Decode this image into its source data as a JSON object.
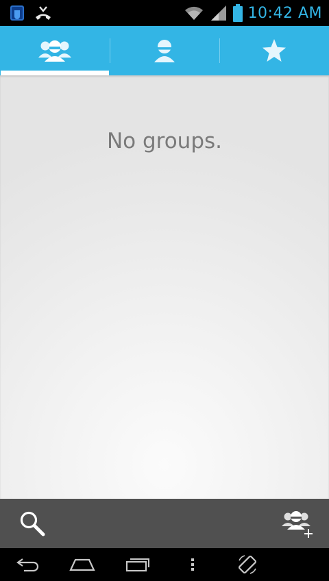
{
  "status_bar": {
    "time": "10:42 AM",
    "icons": [
      "notification-app-icon",
      "missed-call-icon",
      "wifi-icon",
      "signal-icon",
      "battery-icon"
    ]
  },
  "tabs": [
    {
      "name": "groups",
      "icon": "groups-icon",
      "selected": true
    },
    {
      "name": "contacts",
      "icon": "person-icon",
      "selected": false
    },
    {
      "name": "favorites",
      "icon": "star-icon",
      "selected": false
    }
  ],
  "main": {
    "empty_message": "No groups."
  },
  "action_bar": {
    "left_icon": "search-icon",
    "right_icon": "add-group-icon"
  },
  "nav_bar": {
    "icons": [
      "back-icon",
      "home-icon",
      "recent-apps-icon",
      "menu-icon",
      "rotate-icon"
    ]
  },
  "colors": {
    "accent": "#33b5e5",
    "action_bar": "#505050",
    "empty_text": "#7a7a7a"
  }
}
